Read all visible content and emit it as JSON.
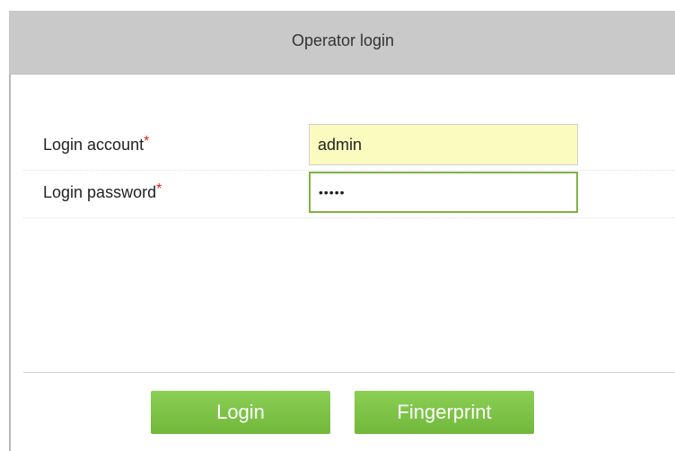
{
  "dialog": {
    "title": "Operator login"
  },
  "form": {
    "account": {
      "label": "Login account",
      "required_mark": "*",
      "value": "admin"
    },
    "password": {
      "label": "Login password",
      "required_mark": "*",
      "value": "•••••"
    }
  },
  "buttons": {
    "login_label": "Login",
    "fingerprint_label": "Fingerprint"
  },
  "colors": {
    "titlebar": "#c9c9c9",
    "button_green": "#7ec247",
    "focus_border": "#7cb342",
    "account_bg": "#fbfbbf",
    "required": "#e02020"
  }
}
